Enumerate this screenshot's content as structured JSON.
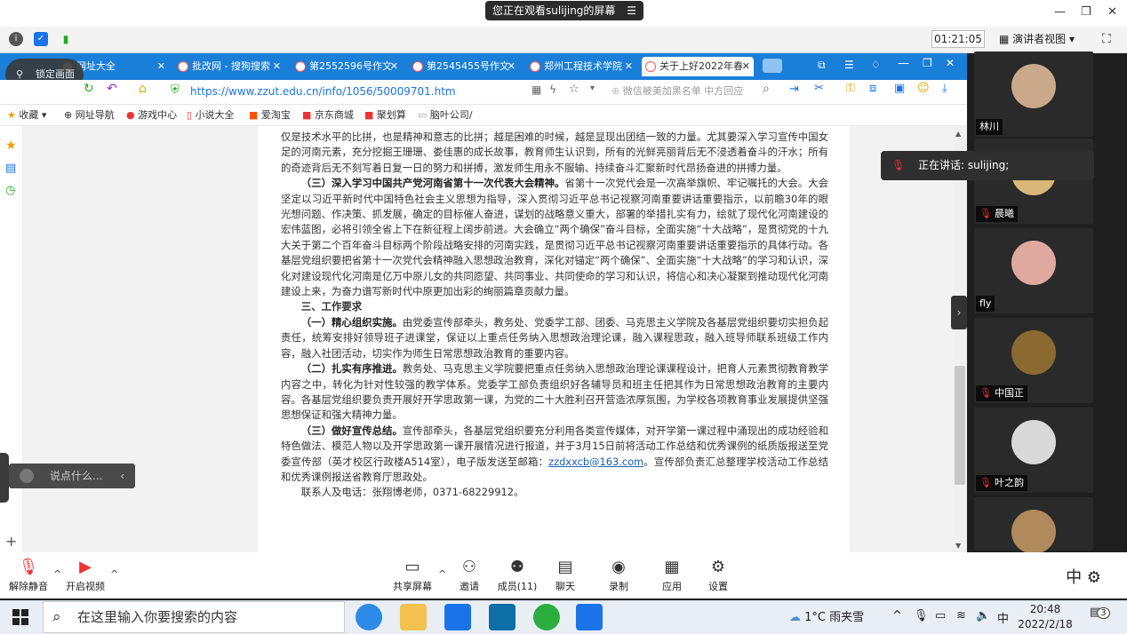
{
  "meeting": {
    "share_notice": "您正在观看sulijing的屏幕",
    "menu_icon": "menu-icon",
    "timer": "01:21:05",
    "view_mode": "演讲者视图",
    "lock_label": "锁定画面",
    "speaking_label": "正在讲话: sulijing;",
    "chat_placeholder": "说点什么...",
    "participants": [
      {
        "name": "林川",
        "muted": false,
        "color": "#c9a98a"
      },
      {
        "name": "晨曦",
        "muted": true,
        "color": "#d8b878"
      },
      {
        "name": "fly",
        "muted": false,
        "color": "#e0a9a0"
      },
      {
        "name": "中国正",
        "muted": true,
        "color": "#8a6a30"
      },
      {
        "name": "叶之韵",
        "muted": true,
        "color": "#d9d9d9"
      },
      {
        "name": "",
        "muted": false,
        "color": "#b08a5a"
      }
    ],
    "toolbar": [
      {
        "label": "解除静音",
        "icon": "mic-muted-icon"
      },
      {
        "label": "开启视频",
        "icon": "video-off-icon"
      },
      {
        "label": "共享屏幕",
        "icon": "share-screen-icon"
      },
      {
        "label": "邀请",
        "icon": "invite-icon"
      },
      {
        "label": "成员(11)",
        "icon": "members-icon"
      },
      {
        "label": "聊天",
        "icon": "chat-icon"
      },
      {
        "label": "录制",
        "icon": "record-icon"
      },
      {
        "label": "应用",
        "icon": "apps-icon"
      },
      {
        "label": "设置",
        "icon": "settings-icon"
      }
    ],
    "ime_mode": "中"
  },
  "browser": {
    "tabs": [
      {
        "label": "网址大全"
      },
      {
        "label": "批改网 - 搜狗搜索"
      },
      {
        "label": "第2552596号作文"
      },
      {
        "label": "第2545455号作文"
      },
      {
        "label": "郑州工程技术学院"
      },
      {
        "label": "关于上好2022年春"
      }
    ],
    "url": "https://www.zzut.edu.cn/info/1056/50009701.htm",
    "search_placeholder": "微信被美加黑名单 中方回应",
    "bookmarks": [
      "收藏",
      "网址导航",
      "游戏中心",
      "小说大全",
      "爱淘宝",
      "京东商城",
      "聚划算",
      "脑叶公司/"
    ]
  },
  "doc": {
    "p0": "仅是技术水平的比拼，也是精神和意志的比拼；越是困难的时候，越是显现出团结一致的力量。尤其要深入学习宣传中国女足的河南元素，充分挖掘王珊珊、娄佳惠的成长故事，教育师生认识到，所有的光鲜亮丽背后无不浸透着奋斗的汗水；所有的奇迹背后无不刻写着日复一日的努力和拼搏，激发师生用永不服输、持续奋斗汇聚新时代昂扬奋进的拼搏力量。",
    "p1_head": "（三）深入学习中国共产党河南省第十一次代表大会精神。",
    "p1": "省第十一次党代会是一次高举旗帜、牢记嘱托的大会。大会坚定以习近平新时代中国特色社会主义思想为指导，深入贯彻习近平总书记视察河南重要讲话重要指示，以前瞻30年的眼光想问题、作决策、抓发展，确定的目标催人奋进，谋划的战略意义重大，部署的举措扎实有力，绘就了现代化河南建设的宏伟蓝图，必将引领全省上下在新征程上阔步前进。大会确立“两个确保”奋斗目标，全面实施“十大战略”，是贯彻党的十九大关于第二个百年奋斗目标两个阶段战略安排的河南实践，是贯彻习近平总书记视察河南重要讲话重要指示的具体行动。各基层党组织要把省第十一次党代会精神融入思想政治教育，深化对锚定“两个确保”、全面实施“十大战略”的学习和认识，深化对建设现代化河南是亿万中原儿女的共同愿望、共同事业、共同使命的学习和认识，将信心和决心凝聚到推动现代化河南建设上来，为奋力谱写新时代中原更加出彩的绚丽篇章贡献力量。",
    "section3": "三、工作要求",
    "r1_head": "（一）精心组织实施。",
    "r1": "由党委宣传部牵头，教务处、党委学工部、团委、马克思主义学院及各基层党组织要切实担负起责任，统筹安排好领导班子进课堂，保证以上重点任务纳入思想政治理论课，融入课程思政，融入班导师联系班级工作内容，融入社团活动，切实作为师生日常思想政治教育的重要内容。",
    "r2_head": "（二）扎实有序推进。",
    "r2": "教务处、马克思主义学院要把重点任务纳入思想政治理论课课程设计，把育人元素贯彻教育教学内容之中，转化为针对性较强的教学体系。党委学工部负责组织好各辅导员和班主任把其作为日常思想政治教育的主要内容。各基层党组织要负责开展好开学思政第一课，为党的二十大胜利召开营造浓厚氛围，为学校各项教育事业发展提供坚强思想保证和强大精神力量。",
    "r3_head": "（三）做好宣传总结。",
    "r3a": "宣传部牵头，各基层党组织要充分利用各类宣传媒体，对开学第一课过程中涌现出的成功经验和特色做法、模范人物以及开学思政第一课开展情况进行报道，并于3月15日前将活动工作总结和优秀课例的纸质版报送至党委宣传部（英才校区行政楼A514室），电子版发送至邮箱：",
    "email": "zzdxxcb@163.com",
    "r3b": "。宣传部负责汇总整理学校活动工作总结和优秀课例报送省教育厅思政处。",
    "contact": "联系人及电话：张翔博老师，0371-68229912。"
  },
  "taskbar": {
    "search_placeholder": "在这里输入你要搜索的内容",
    "weather": "1°C  雨夹雪",
    "ime": "中",
    "time": "20:48",
    "date": "2022/2/18",
    "notifications": "3"
  }
}
